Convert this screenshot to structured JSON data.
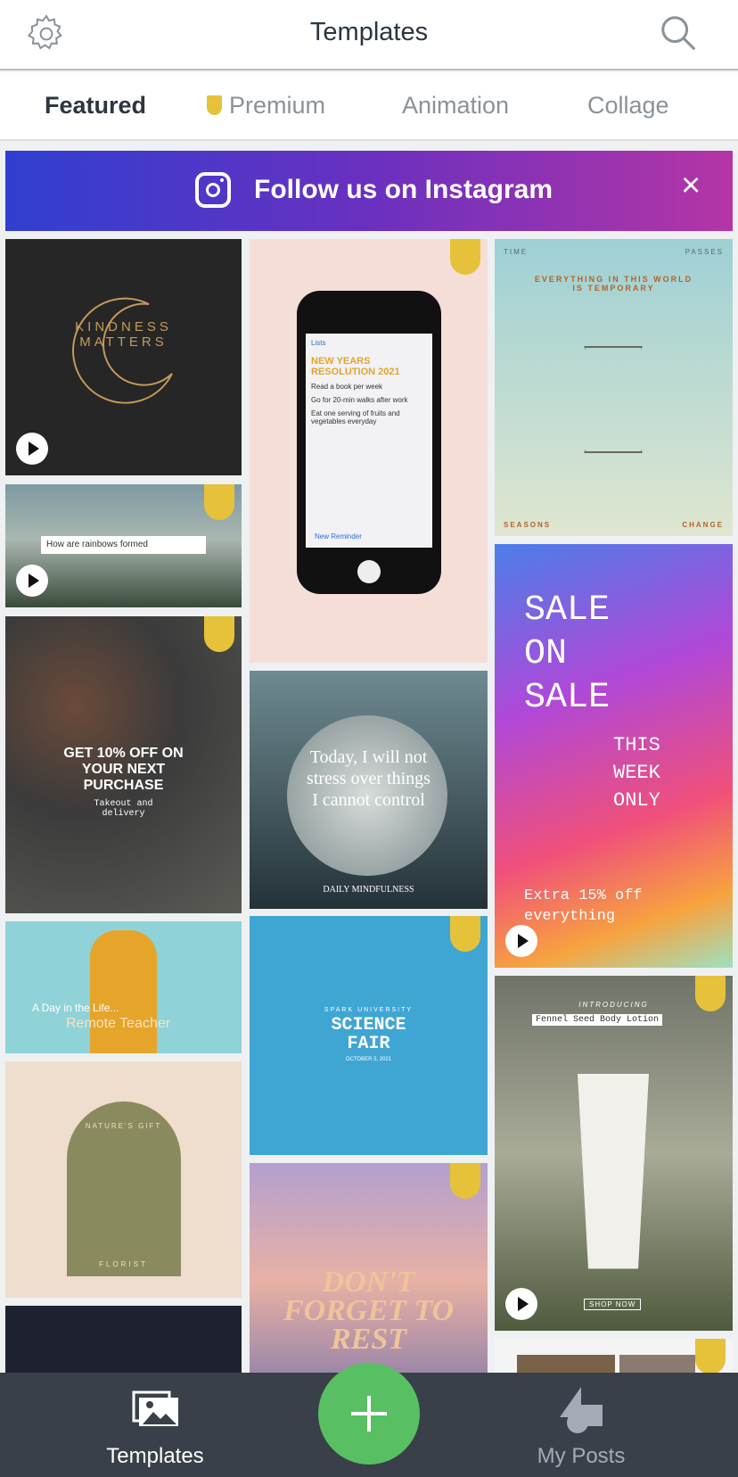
{
  "header": {
    "title": "Templates",
    "left_icon": "gear-icon",
    "right_icon": "search-icon"
  },
  "tabs": [
    {
      "label": "Featured",
      "active": true
    },
    {
      "label": "Premium",
      "premium": true
    },
    {
      "label": "Animation"
    },
    {
      "label": "Collage"
    }
  ],
  "banner": {
    "text": "Follow us on Instagram",
    "icon": "instagram-icon",
    "close": "×"
  },
  "tiles": {
    "kindness": "KINDNESS MATTERS",
    "rainbow": "How are rainbows formed",
    "food": {
      "headline": "GET 10% OFF ON YOUR NEXT PURCHASE",
      "sub": "Takeout and delivery"
    },
    "teacher": {
      "line1": "A Day in the Life...",
      "line2": "Remote Teacher"
    },
    "florist": {
      "top": "NATURE'S GIFT",
      "bottom": "FLORIST"
    },
    "phone": {
      "back": "Lists",
      "title": "NEW YEARS RESOLUTION 2021",
      "items": [
        "Read a book per week",
        "Go for 20-min walks after work",
        "Eat one serving of fruits and vegetables everyday"
      ],
      "action": "New Reminder"
    },
    "mindful": {
      "quote": "Today, I will not stress over things I cannot control",
      "footer": "DAILY MINDFULNESS"
    },
    "science": {
      "uni": "SPARK UNIVERSITY",
      "title": "SCIENCE FAIR",
      "date": "OCTOBER 5, 2021"
    },
    "rest": "DON'T FORGET TO REST",
    "time": {
      "tl": "TIME",
      "tr": "PASSES",
      "arc": "EVERYTHING IN THIS WORLD IS TEMPORARY",
      "bl": "SEASONS",
      "br": "CHANGE"
    },
    "sale": {
      "big": "SALE ON SALE",
      "week": "THIS WEEK ONLY",
      "extra": "Extra 15% off everything"
    },
    "lotion": {
      "intro": "INTRODUCING",
      "name": "Fennel Seed Body Lotion",
      "cta": "SHOP NOW"
    }
  },
  "nav": {
    "templates": "Templates",
    "my_posts": "My Posts"
  },
  "colors": {
    "premium": "#e6c23a",
    "fab": "#58bf62",
    "nav_bg": "#394049"
  }
}
